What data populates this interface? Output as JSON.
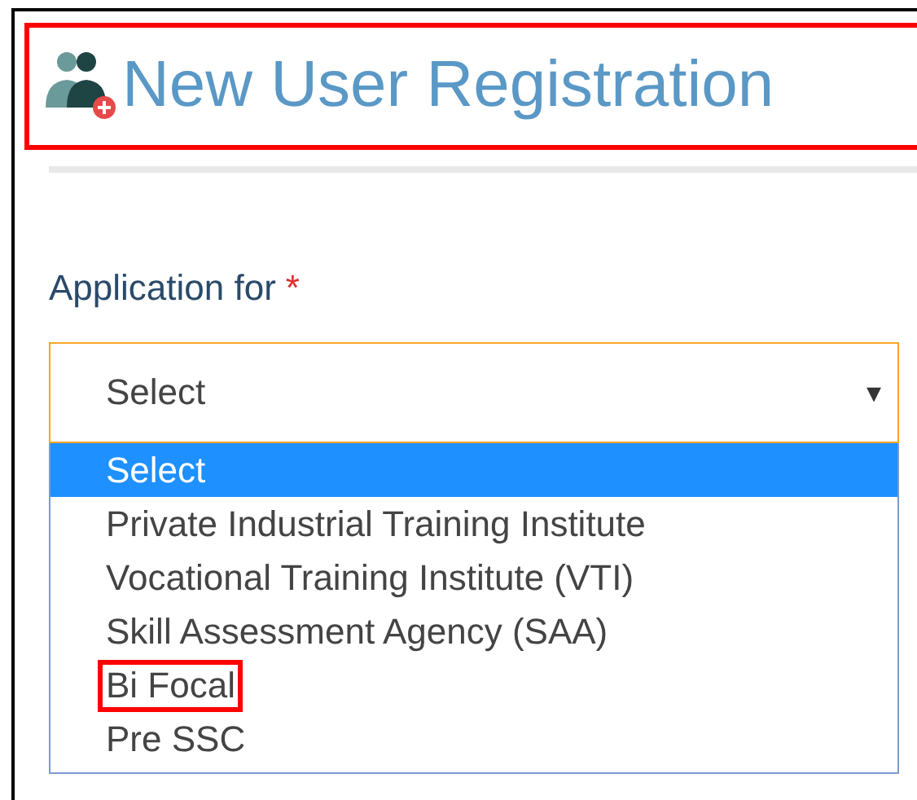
{
  "page_title": {
    "text": "New User Registration",
    "highlighted": true
  },
  "field": {
    "label": "Application for",
    "required_mark": "*",
    "value": "Select",
    "arrow": "▾",
    "expanded": true
  },
  "options": [
    {
      "label": "Select",
      "selected": true,
      "highlighted": false
    },
    {
      "label": "Private Industrial Training Institute",
      "selected": false,
      "highlighted": false
    },
    {
      "label": "Vocational Training Institute (VTI)",
      "selected": false,
      "highlighted": false
    },
    {
      "label": "Skill Assessment Agency (SAA)",
      "selected": false,
      "highlighted": false
    },
    {
      "label": "Bi Focal",
      "selected": false,
      "highlighted": true
    },
    {
      "label": "Pre SSC",
      "selected": false,
      "highlighted": false
    }
  ]
}
